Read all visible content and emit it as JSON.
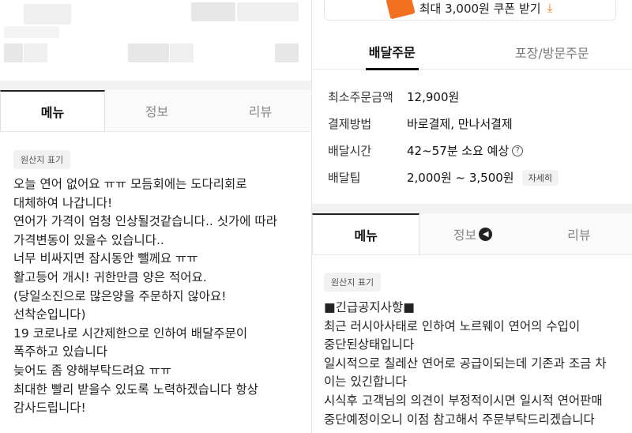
{
  "left_panel": {
    "tabs": [
      {
        "label": "메뉴"
      },
      {
        "label": "정보"
      },
      {
        "label": "리뷰"
      }
    ],
    "origin_badge": "원산지 표기",
    "notice_lines": [
      "오늘 연어 없어요 ㅠㅠ 모듬회에는 도다리회로",
      "대체하여 나갑니다!",
      "연어가 가격이 엄청 인상될것같습니다.. 싯가에 따라",
      "가격변동이 있을수 있습니다..",
      "너무 비싸지면 잠시동안 뺄께요 ㅠㅠ",
      "활고등어 개시! 귀한만큼 양은 적어요.",
      "(당일소진으로 많은양을 주문하지 않아요!",
      "선착순입니다)",
      "19 코로나로 시간제한으로 인하여 배달주문이",
      "폭주하고 있습니다",
      "늦어도 좀 양해부탁드려요 ㅠㅠ",
      "최대한 빨리 받을수 있도록 노력하겠습니다 항상",
      "감사드립니다!"
    ]
  },
  "right_panel": {
    "coupon": {
      "label": "최대 3,000원 쿠폰 받기",
      "arrow": "⤓"
    },
    "order_tabs": [
      {
        "label": "배달주문"
      },
      {
        "label": "포장/방문주문"
      }
    ],
    "info_rows": [
      {
        "label": "최소주문금액",
        "value": "12,900원"
      },
      {
        "label": "결제방법",
        "value": "바로결제, 만나서결제"
      },
      {
        "label": "배달시간",
        "value": "42~57분 소요 예상"
      },
      {
        "label": "배달팁",
        "value": "2,000원 ~ 3,500원"
      }
    ],
    "help_icon": "?",
    "detail_button": "자세히",
    "tabs": [
      {
        "label": "메뉴"
      },
      {
        "label": "정보"
      },
      {
        "label": "리뷰"
      }
    ],
    "info_tab_icon": "◀",
    "origin_badge": "원산지 표기",
    "notice_lines": [
      "■긴급공지사항■",
      "최근 러시아사태로 인하여 노르웨이 연어의 수입이",
      "중단된상태입니다",
      "일시적으로 칠레산 연어로 공급이되는데 기존과 조금 차",
      "이는 있긴합니다",
      "시식후 고객님의 의견이 부정적이시면  일시적 연어판매",
      "중단예정이오니 이점 참고해서 주문부탁드리겠습니다"
    ]
  },
  "colors": {
    "accent": "#f37021",
    "badge_bg": "#f1f1f1",
    "divider": "#e8e8e8"
  }
}
